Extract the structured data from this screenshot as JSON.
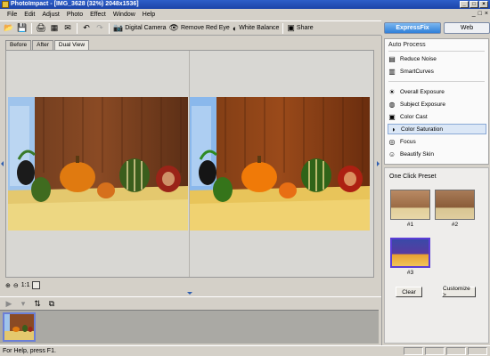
{
  "window": {
    "title": "PhotoImpact - [IMG_3628 (32%) 2048x1536]",
    "controls": [
      "_",
      "□",
      "×"
    ]
  },
  "menu": {
    "items": [
      "File",
      "Edit",
      "Adjust",
      "Photo",
      "Effect",
      "Window",
      "Help"
    ],
    "right_controls": [
      "_",
      "□",
      "×"
    ]
  },
  "toolbar": {
    "digital_camera": "Digital Camera",
    "remove_red_eye": "Remove Red Eye",
    "white_balance": "White Balance",
    "share": "Share"
  },
  "mode_tabs": {
    "expressfix": "ExpressFix",
    "web": "Web"
  },
  "doc_tabs": [
    "Before",
    "After",
    "Dual View"
  ],
  "zoom": {
    "zoom_in": "⊕",
    "zoom_out": "⊖",
    "actual": "1:1"
  },
  "right_panel": {
    "auto_process_header": "Auto Process",
    "auto_items": [
      "Reduce Noise",
      "SmartCurves"
    ],
    "fix_items": [
      "Overall Exposure",
      "Subject Exposure",
      "Color Cast",
      "Color Saturation",
      "Focus",
      "Beautify Skin"
    ],
    "selected_fix": "Color Saturation",
    "one_click_header": "One Click Preset",
    "presets": [
      "#1",
      "#2",
      "#3"
    ],
    "selected_preset": "#3",
    "clear_button": "Clear",
    "customize_button": "Customize >"
  },
  "status": {
    "text": "For Help, press F1."
  },
  "colors": {
    "title_bar": "#1c44a8",
    "accent": "#2f7fd9",
    "selection": "#dbe7f6"
  }
}
